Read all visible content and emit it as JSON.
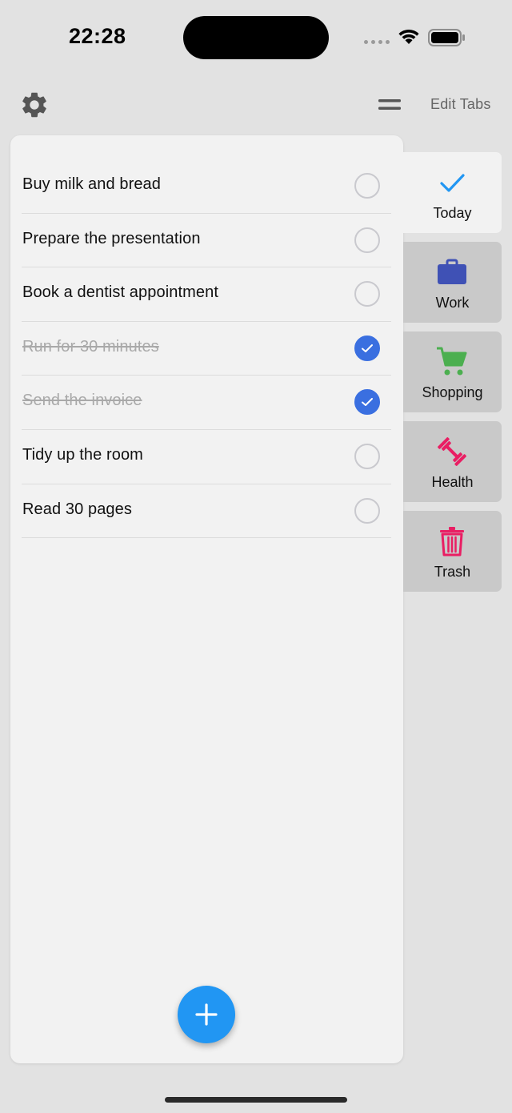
{
  "status_bar": {
    "time": "22:28"
  },
  "top_bar": {
    "edit_tabs_label": "Edit Tabs"
  },
  "tasks": [
    {
      "label": "Buy milk and bread",
      "done": false
    },
    {
      "label": "Prepare the presentation",
      "done": false
    },
    {
      "label": "Book a dentist appointment",
      "done": false
    },
    {
      "label": "Run for 30 minutes",
      "done": true
    },
    {
      "label": "Send the invoice",
      "done": true
    },
    {
      "label": "Tidy up the room",
      "done": false
    },
    {
      "label": "Read 30 pages",
      "done": false
    }
  ],
  "tabs": [
    {
      "label": "Today",
      "icon": "checkmark-icon",
      "color": "#2196f3",
      "active": true
    },
    {
      "label": "Work",
      "icon": "briefcase-icon",
      "color": "#3f51b5",
      "active": false
    },
    {
      "label": "Shopping",
      "icon": "shopping-cart-icon",
      "color": "#4caf50",
      "active": false
    },
    {
      "label": "Health",
      "icon": "dumbbell-icon",
      "color": "#e91e63",
      "active": false
    },
    {
      "label": "Trash",
      "icon": "trash-icon",
      "color": "#e91e63",
      "active": false
    }
  ],
  "colors": {
    "accent": "#2196f3",
    "checked": "#3a6fe0",
    "background": "#e2e2e2",
    "panel": "#f2f2f2"
  }
}
